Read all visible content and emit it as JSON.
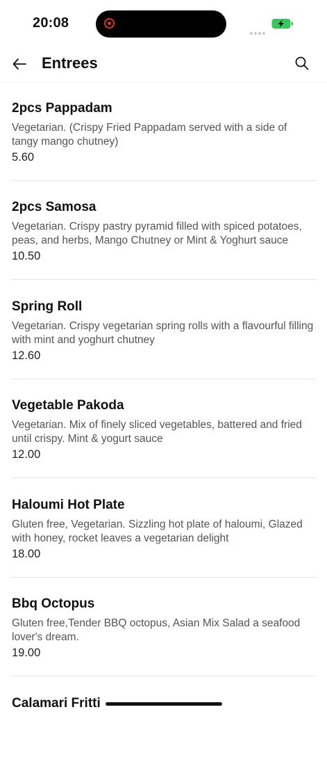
{
  "status_bar": {
    "time": "20:08"
  },
  "header": {
    "title": "Entrees",
    "back_icon": "arrow-left-icon",
    "search_icon": "search-icon"
  },
  "items": [
    {
      "name": "2pcs Pappadam",
      "description": "Vegetarian. (Crispy Fried Pappadam served with a side of tangy mango chutney)",
      "price": "5.60"
    },
    {
      "name": "2pcs Samosa",
      "description": "Vegetarian. Crispy pastry pyramid filled with spiced potatoes, peas, and herbs, Mango Chutney or Mint & Yoghurt sauce",
      "price": "10.50"
    },
    {
      "name": "Spring Roll",
      "description": "Vegetarian. Crispy vegetarian spring rolls with a flavourful filling with mint and yoghurt chutney",
      "price": "12.60"
    },
    {
      "name": "Vegetable Pakoda",
      "description": "Vegetarian. Mix of finely sliced vegetables, battered and fried until crispy. Mint & yogurt sauce",
      "price": "12.00"
    },
    {
      "name": "Haloumi Hot Plate",
      "description": "Gluten free, Vegetarian. Sizzling hot plate of haloumi, Glazed with honey, rocket leaves a vegetarian delight",
      "price": "18.00"
    },
    {
      "name": "Bbq Octopus",
      "description": "Gluten free,Tender BBQ octopus, Asian Mix Salad a seafood lover's dream.",
      "price": "19.00"
    },
    {
      "name": "Calamari Fritti",
      "description": "",
      "price": ""
    }
  ],
  "colors": {
    "background": "#ffffff",
    "text_primary": "#111111",
    "text_secondary": "#555555",
    "divider": "#e4e4e4",
    "battery_green": "#34c759"
  }
}
